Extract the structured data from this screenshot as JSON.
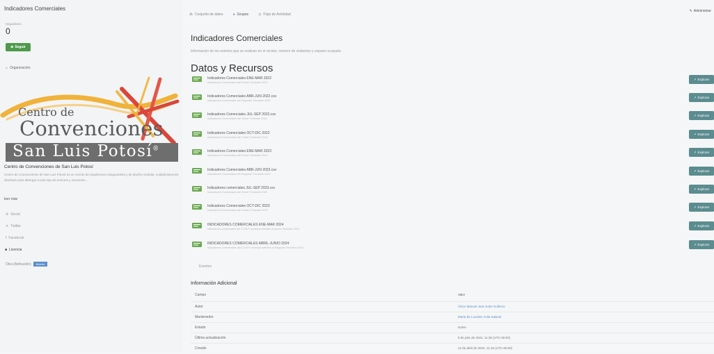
{
  "sidebar": {
    "title": "Indicadores Comerciales",
    "followers_label": "Seguidores",
    "followers_count": "0",
    "follow_button": "Seguir",
    "organization_label": "Organización",
    "logo": {
      "line1": "Centro de",
      "line2": "Convenciones",
      "line3": "San Luis Potosí",
      "registered": "®"
    },
    "org_name": "Centro de Convenciones de San Luis Potosí",
    "org_description": "Centro de Convenciones de San Luis Potosí es un recinto de arquitectura vanguardista y de diseño modular, cuidadosamente diseñado para albergar a todo tipo de eventos y reuniones...",
    "see_more": "leer más",
    "social_label": "Social",
    "social": [
      "Twitter",
      "Facebook"
    ],
    "license_label": "Licencia",
    "license_text": "Otra (Atribución)",
    "license_badge": "Abierto"
  },
  "nav": {
    "tabs": [
      "Conjunto de datos",
      "Grupos",
      "Flujo de Actividad"
    ],
    "admin": "Administrar"
  },
  "dataset": {
    "title": "Indicadores Comerciales",
    "description": "Información de los eventos que se realizan en el recinto, número de visitantes y espacio ocupado."
  },
  "resources": {
    "title": "Datos y Recursos",
    "explore_label": "Explorar",
    "items": [
      {
        "name": "Indicadores Comerciales ENE-MAR 2022",
        "sub": "Indicadores Comerciales del Primer Trimestre 2022"
      },
      {
        "name": "Indicadores Comerciales ABR-JUN 2022.csv",
        "sub": "Indicadores Comerciales del Segundo Trimestre 2022"
      },
      {
        "name": "Indicadores Comerciales JUL-SEP 2022.csv",
        "sub": "Indicadores Comerciales del Tercer Trimestre 2022"
      },
      {
        "name": "Indicadores Comerciales OCT-DIC 2022",
        "sub": "Indicadores Comerciales del Cuarto Trimestre 2022"
      },
      {
        "name": "Indicadores Comerciales ENE-MAR 2023",
        "sub": "Indicadores Comerciales del Primer Trimestre 2023"
      },
      {
        "name": "Indicadores Comerciales ABR-JUN 2023.csv",
        "sub": "Indicadores Comerciales del Segundo Trimestre 2023"
      },
      {
        "name": "Indicadores comerciales JUL-SEP 2023.csv",
        "sub": "Indicadores Comerciales del Tercer Trimestre 2023"
      },
      {
        "name": "Indicadores Comerciales OCT-DIC 2023",
        "sub": "Indicadores Comerciales del Cuarto Trimestre 2023"
      },
      {
        "name": "INDICADORES COMERCIALES ENE-MAR 2024",
        "sub": "Indicadores comerciales del CCSLP correspondientes al primer trimestre 2024"
      },
      {
        "name": "INDICADORES COMERCIALES ABRIL-JUNIO 2024",
        "sub": "Indicadores Comerciales del CCSLP correspondientes al Segundo Trimestre 2024"
      }
    ]
  },
  "events_label": "Eventos",
  "additional_info": {
    "title": "Información Adicional",
    "header_field": "Campo",
    "header_value": "Valor",
    "rows": [
      {
        "field": "Autor",
        "value": "Victor Manuel Jose Soler Sollerno",
        "link": true
      },
      {
        "field": "Mantenedor",
        "value": "María de Lourdes Ávila Salazar",
        "link": true
      },
      {
        "field": "Estado",
        "value": "active",
        "link": false
      },
      {
        "field": "Última actualización",
        "value": "8 de julio de 2024, 11:35 (UTC-06:00)",
        "link": false
      },
      {
        "field": "Creado",
        "value": "12 de abril de 2022, 11:16 (UTC-06:00)",
        "link": false
      }
    ]
  },
  "colors": {
    "follow_button": "#4e9a4b",
    "explore_button": "#5b8c8f",
    "link": "#5b8fc9",
    "logo_gold": "#f0b23a",
    "logo_red": "#d9473a",
    "logo_grey": "#6e6e6e"
  }
}
